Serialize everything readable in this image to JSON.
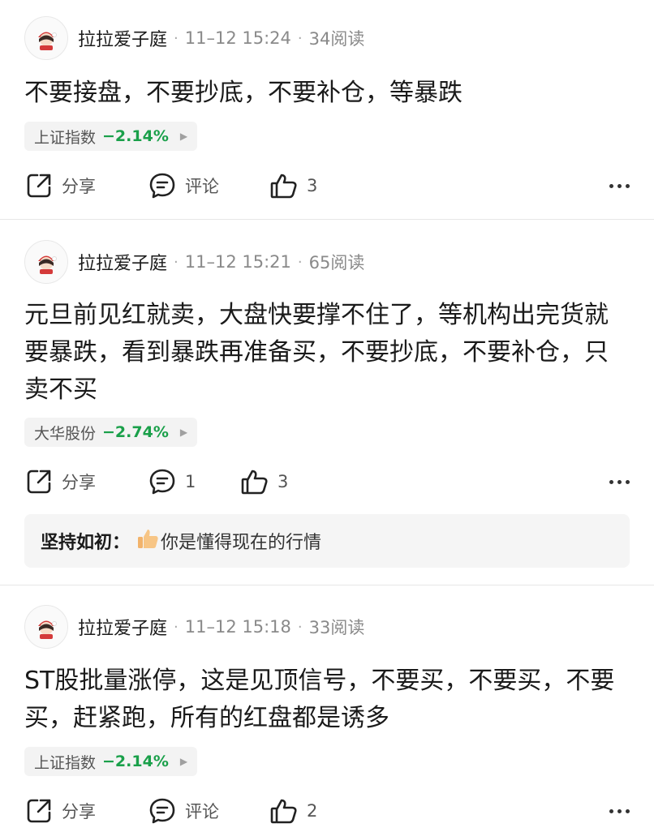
{
  "posts": [
    {
      "author": "拉拉爱子庭",
      "time": "11–12 15:24",
      "reads": "34阅读",
      "content": "不要接盘，不要抄底，不要补仓，等暴跌",
      "stock": {
        "name": "上证指数",
        "change": "−2.14%"
      },
      "actions": {
        "share": "分享",
        "comment": "评论",
        "likes": "3"
      }
    },
    {
      "author": "拉拉爱子庭",
      "time": "11–12 15:21",
      "reads": "65阅读",
      "content": "元旦前见红就卖，大盘快要撑不住了，等机构出完货就要暴跌，看到暴跌再准备买，不要抄底，不要补仓，只卖不买",
      "stock": {
        "name": "大华股份",
        "change": "−2.74%"
      },
      "actions": {
        "share": "分享",
        "comment": "1",
        "likes": "3"
      },
      "reply": {
        "user": "坚持如初：",
        "text": "你是懂得现在的行情"
      }
    },
    {
      "author": "拉拉爱子庭",
      "time": "11–12 15:18",
      "reads": "33阅读",
      "content": "ST股批量涨停，这是见顶信号，不要买，不要买，不要买，赶紧跑，所有的红盘都是诱多",
      "stock": {
        "name": "上证指数",
        "change": "−2.14%"
      },
      "actions": {
        "share": "分享",
        "comment": "评论",
        "likes": "2"
      }
    }
  ],
  "dot": "·",
  "colors": {
    "down": "#1aa04a",
    "text": "#1a1a1a",
    "muted": "#8a8a8a"
  },
  "icons": [
    "avatar-icon",
    "share-icon",
    "comment-icon",
    "like-icon",
    "more-icon",
    "thumbs-up-icon"
  ]
}
